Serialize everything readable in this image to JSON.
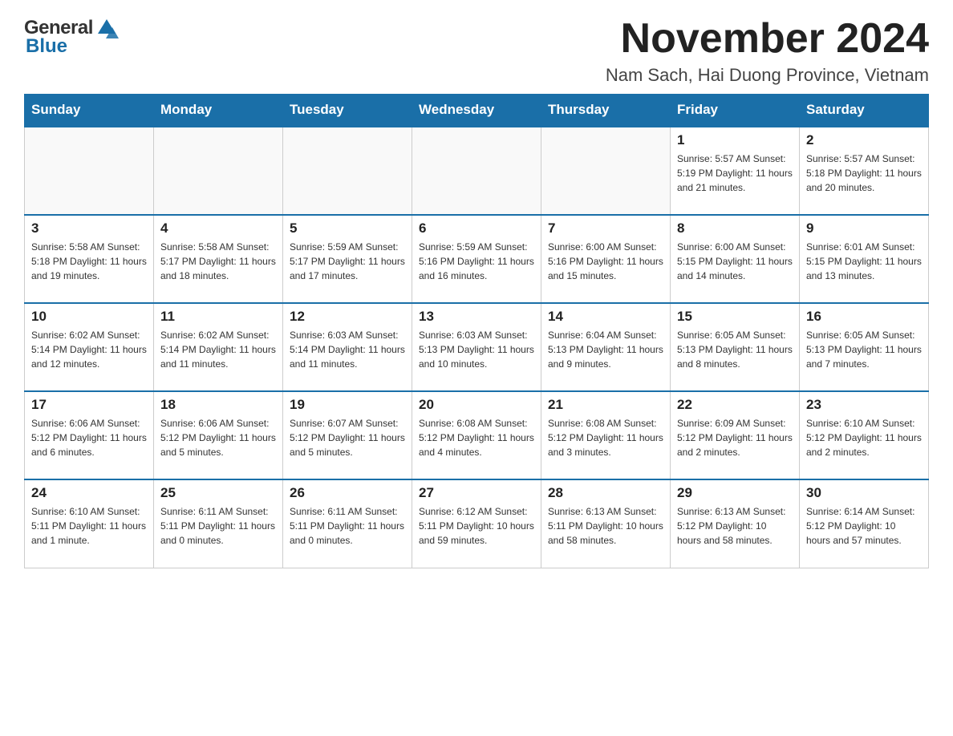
{
  "header": {
    "logo": {
      "general": "General",
      "blue": "Blue"
    },
    "month_title": "November 2024",
    "location": "Nam Sach, Hai Duong Province, Vietnam"
  },
  "weekdays": [
    "Sunday",
    "Monday",
    "Tuesday",
    "Wednesday",
    "Thursday",
    "Friday",
    "Saturday"
  ],
  "weeks": [
    [
      {
        "day": "",
        "info": ""
      },
      {
        "day": "",
        "info": ""
      },
      {
        "day": "",
        "info": ""
      },
      {
        "day": "",
        "info": ""
      },
      {
        "day": "",
        "info": ""
      },
      {
        "day": "1",
        "info": "Sunrise: 5:57 AM\nSunset: 5:19 PM\nDaylight: 11 hours\nand 21 minutes."
      },
      {
        "day": "2",
        "info": "Sunrise: 5:57 AM\nSunset: 5:18 PM\nDaylight: 11 hours\nand 20 minutes."
      }
    ],
    [
      {
        "day": "3",
        "info": "Sunrise: 5:58 AM\nSunset: 5:18 PM\nDaylight: 11 hours\nand 19 minutes."
      },
      {
        "day": "4",
        "info": "Sunrise: 5:58 AM\nSunset: 5:17 PM\nDaylight: 11 hours\nand 18 minutes."
      },
      {
        "day": "5",
        "info": "Sunrise: 5:59 AM\nSunset: 5:17 PM\nDaylight: 11 hours\nand 17 minutes."
      },
      {
        "day": "6",
        "info": "Sunrise: 5:59 AM\nSunset: 5:16 PM\nDaylight: 11 hours\nand 16 minutes."
      },
      {
        "day": "7",
        "info": "Sunrise: 6:00 AM\nSunset: 5:16 PM\nDaylight: 11 hours\nand 15 minutes."
      },
      {
        "day": "8",
        "info": "Sunrise: 6:00 AM\nSunset: 5:15 PM\nDaylight: 11 hours\nand 14 minutes."
      },
      {
        "day": "9",
        "info": "Sunrise: 6:01 AM\nSunset: 5:15 PM\nDaylight: 11 hours\nand 13 minutes."
      }
    ],
    [
      {
        "day": "10",
        "info": "Sunrise: 6:02 AM\nSunset: 5:14 PM\nDaylight: 11 hours\nand 12 minutes."
      },
      {
        "day": "11",
        "info": "Sunrise: 6:02 AM\nSunset: 5:14 PM\nDaylight: 11 hours\nand 11 minutes."
      },
      {
        "day": "12",
        "info": "Sunrise: 6:03 AM\nSunset: 5:14 PM\nDaylight: 11 hours\nand 11 minutes."
      },
      {
        "day": "13",
        "info": "Sunrise: 6:03 AM\nSunset: 5:13 PM\nDaylight: 11 hours\nand 10 minutes."
      },
      {
        "day": "14",
        "info": "Sunrise: 6:04 AM\nSunset: 5:13 PM\nDaylight: 11 hours\nand 9 minutes."
      },
      {
        "day": "15",
        "info": "Sunrise: 6:05 AM\nSunset: 5:13 PM\nDaylight: 11 hours\nand 8 minutes."
      },
      {
        "day": "16",
        "info": "Sunrise: 6:05 AM\nSunset: 5:13 PM\nDaylight: 11 hours\nand 7 minutes."
      }
    ],
    [
      {
        "day": "17",
        "info": "Sunrise: 6:06 AM\nSunset: 5:12 PM\nDaylight: 11 hours\nand 6 minutes."
      },
      {
        "day": "18",
        "info": "Sunrise: 6:06 AM\nSunset: 5:12 PM\nDaylight: 11 hours\nand 5 minutes."
      },
      {
        "day": "19",
        "info": "Sunrise: 6:07 AM\nSunset: 5:12 PM\nDaylight: 11 hours\nand 5 minutes."
      },
      {
        "day": "20",
        "info": "Sunrise: 6:08 AM\nSunset: 5:12 PM\nDaylight: 11 hours\nand 4 minutes."
      },
      {
        "day": "21",
        "info": "Sunrise: 6:08 AM\nSunset: 5:12 PM\nDaylight: 11 hours\nand 3 minutes."
      },
      {
        "day": "22",
        "info": "Sunrise: 6:09 AM\nSunset: 5:12 PM\nDaylight: 11 hours\nand 2 minutes."
      },
      {
        "day": "23",
        "info": "Sunrise: 6:10 AM\nSunset: 5:12 PM\nDaylight: 11 hours\nand 2 minutes."
      }
    ],
    [
      {
        "day": "24",
        "info": "Sunrise: 6:10 AM\nSunset: 5:11 PM\nDaylight: 11 hours\nand 1 minute."
      },
      {
        "day": "25",
        "info": "Sunrise: 6:11 AM\nSunset: 5:11 PM\nDaylight: 11 hours\nand 0 minutes."
      },
      {
        "day": "26",
        "info": "Sunrise: 6:11 AM\nSunset: 5:11 PM\nDaylight: 11 hours\nand 0 minutes."
      },
      {
        "day": "27",
        "info": "Sunrise: 6:12 AM\nSunset: 5:11 PM\nDaylight: 10 hours\nand 59 minutes."
      },
      {
        "day": "28",
        "info": "Sunrise: 6:13 AM\nSunset: 5:11 PM\nDaylight: 10 hours\nand 58 minutes."
      },
      {
        "day": "29",
        "info": "Sunrise: 6:13 AM\nSunset: 5:12 PM\nDaylight: 10 hours\nand 58 minutes."
      },
      {
        "day": "30",
        "info": "Sunrise: 6:14 AM\nSunset: 5:12 PM\nDaylight: 10 hours\nand 57 minutes."
      }
    ]
  ]
}
